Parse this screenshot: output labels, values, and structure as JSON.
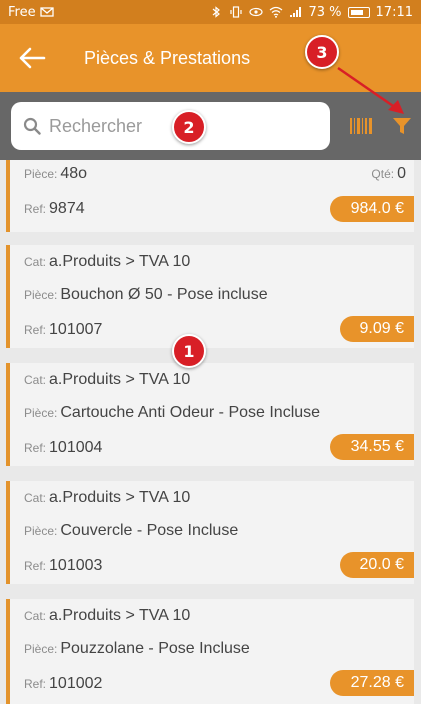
{
  "status": {
    "carrier": "Free",
    "battery": "73 %",
    "time": "17:11"
  },
  "appbar": {
    "title": "Pièces & Prestations"
  },
  "search": {
    "placeholder": "Rechercher"
  },
  "labels": {
    "cat": "Cat:",
    "piece": "Pièce:",
    "ref": "Ref:",
    "qty": "Qté:"
  },
  "items": [
    {
      "piece": "48o",
      "qty": "0",
      "ref": "9874",
      "price": "984.0 €"
    },
    {
      "cat": "a.Produits > TVA 10",
      "piece": "Bouchon Ø 50 - Pose incluse",
      "ref": "101007",
      "price": "9.09 €"
    },
    {
      "cat": "a.Produits > TVA 10",
      "piece": "Cartouche Anti Odeur - Pose Incluse",
      "ref": "101004",
      "price": "34.55 €"
    },
    {
      "cat": "a.Produits > TVA 10",
      "piece": "Couvercle - Pose Incluse",
      "ref": "101003",
      "price": "20.0 €"
    },
    {
      "cat": "a.Produits > TVA 10",
      "piece": "Pouzzolane - Pose Incluse",
      "ref": "101002",
      "price": "27.28 €"
    }
  ],
  "annotations": {
    "one": "1",
    "two": "2",
    "three": "3"
  },
  "colors": {
    "accent": "#e8932a",
    "marker": "#d81f26"
  }
}
